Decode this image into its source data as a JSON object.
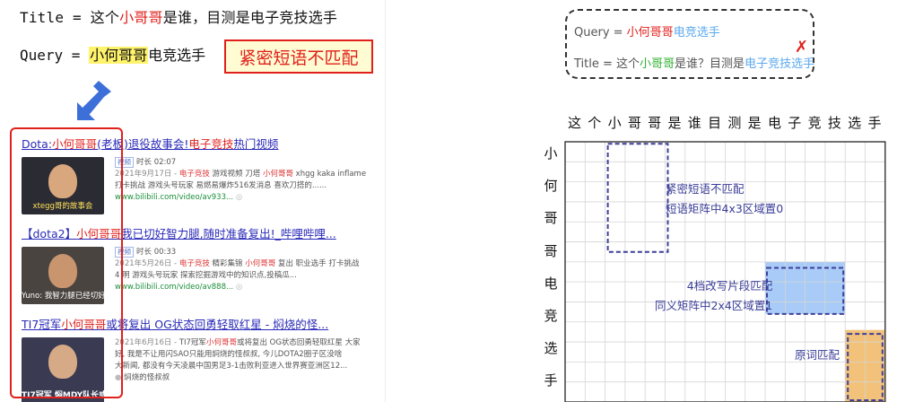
{
  "left_panel": {
    "title_prefix": "Title = ",
    "title_before": "这个",
    "title_hit": "小哥哥",
    "title_after": "是谁，目测是电子竞技选手",
    "query_prefix": "Query = ",
    "query_hit": "小何哥哥",
    "query_after": "电竞选手",
    "mismatch_label": "紧密短语不匹配",
    "results": [
      {
        "title_a": "Dota:",
        "title_hit": "小何哥哥",
        "title_b": "(老板)退役故事会!",
        "title_hit2": "电子竞技",
        "title_c": "热门视频",
        "badge": "视频",
        "duration": "时长 02:07",
        "line1_date": "2021年9月17日 - ",
        "line1_kw": "电子竞技",
        "line1_rest": " 游戏视频 刀塔 ",
        "line1_kw2": "小何哥哥",
        "line1_tail": " xhgg kaka inflame",
        "line2": "打卡挑战 游戏头号玩家 易燃易爆炸516发消息 喜欢刀搭的......",
        "url": "www.bilibili.com/video/av933...",
        "thumb_caption": "xtegg哥的故事会"
      },
      {
        "title_a": "【dota2】",
        "title_hit": "小何哥哥",
        "title_b": "我已切好智力腿,随时准备复出!_哔哩哔哩...",
        "title_hit2": "",
        "title_c": "",
        "badge": "视频",
        "duration": "时长 00:33",
        "line1_date": "2021年5月26日 - ",
        "line1_kw": "电子竞技",
        "line1_rest": " 精彩集锦 ",
        "line1_kw2": "小何哥哥",
        "line1_tail": " 复出 职业选手 打卡挑战",
        "line2": "4 明 游戏头号玩家 探索挖掘游戏中的知识点,投稿瓜...",
        "url": "www.bilibili.com/video/av888...",
        "thumb_caption": "Yuno: 我智力腿已经切好了"
      },
      {
        "title_a": "TI7冠军",
        "title_hit": "小何哥哥",
        "title_b": "或将复出 OG状态回勇轻取红星 - 焖烧的怪...",
        "title_hit2": "",
        "title_c": "",
        "badge": "",
        "duration": "",
        "line1_date": "2021年6月16日 - ",
        "line1_kw": "",
        "line1_rest": "TI7冠军",
        "line1_kw2": "小何哥哥",
        "line1_tail": "或将复出 OG状态回勇轻取红星 大家",
        "line2": "好, 我是不让用闪SAO只能用焖烧的怪叔叔, 今儿DOTA2圈子区没啥",
        "line3": "大新闻, 都没有今天凌晨中国男足3-1击败利亚进入世界赛亚洲区12...",
        "url": "焖烧的怪叔叔",
        "thumb_caption": "TI7冠军 焖MDY队长或将复出"
      }
    ]
  },
  "right_panel": {
    "query_label": "Query = ",
    "query_hit": "小何哥哥",
    "query_rest": "电竞选手",
    "title_label": "Title = 这个",
    "title_hit": "小哥哥",
    "title_mid": "是谁？目测是",
    "title_hit2": "电子竞技选手",
    "cross": "✗",
    "column_chars": [
      "这",
      "个",
      "小",
      "哥",
      "哥",
      "是",
      "谁",
      "目",
      "测",
      "是",
      "电",
      "子",
      "竞",
      "技",
      "选",
      "手"
    ],
    "row_chars": [
      "小",
      "何",
      "哥",
      "哥",
      "电",
      "竞",
      "选",
      "手"
    ],
    "annotations": {
      "a1_line1": "紧密短语不匹配",
      "a1_line2": "短语矩阵中4x3区域置0",
      "a2_line1": "4档改写片段匹配",
      "a2_line2": "同义矩阵中2x4区域置1",
      "a3": "原词匹配"
    },
    "colors": {
      "blue_fill": "#a8ccf7",
      "orange_fill": "#f2c27a",
      "dash": "#3f3f9a"
    }
  }
}
